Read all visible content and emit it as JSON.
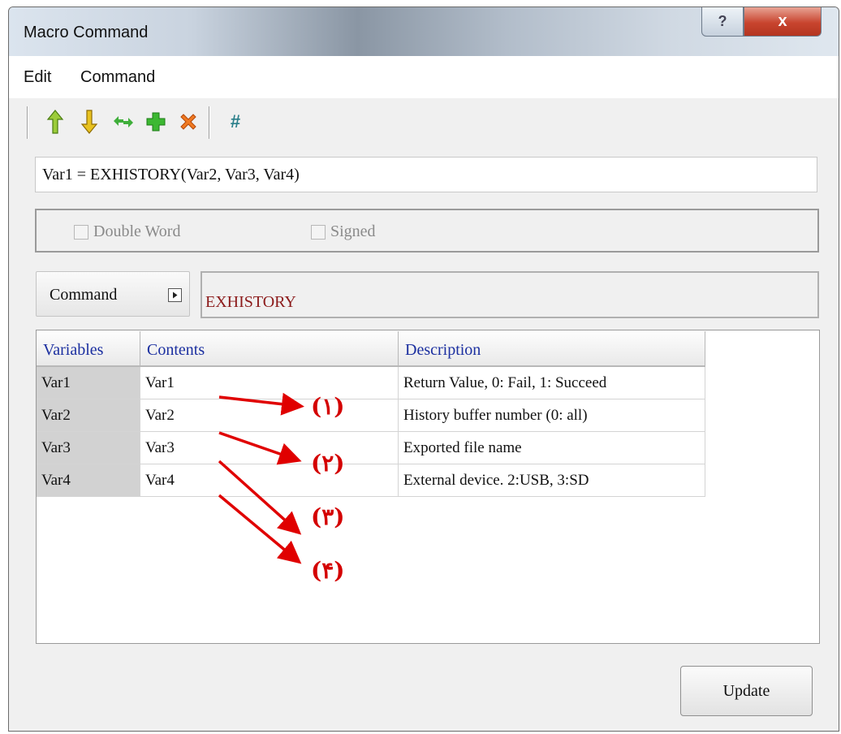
{
  "window": {
    "title": "Macro Command",
    "help_glyph": "?",
    "close_glyph": "x"
  },
  "menu": {
    "items": [
      "Edit",
      "Command"
    ]
  },
  "toolbar": {
    "icons": [
      "move-up-icon",
      "move-down-icon",
      "replace-icon",
      "add-icon",
      "delete-icon"
    ],
    "hash_label": "#"
  },
  "expression": "Var1 = EXHISTORY(Var2, Var3, Var4)",
  "options": {
    "double_word_label": "Double Word",
    "signed_label": "Signed"
  },
  "command": {
    "button_label": "Command",
    "value": "EXHISTORY"
  },
  "table": {
    "headers": [
      "Variables",
      "Contents",
      "Description"
    ],
    "rows": [
      {
        "variable": "Var1",
        "content": "Var1",
        "description": "Return Value, 0: Fail, 1: Succeed"
      },
      {
        "variable": "Var2",
        "content": "Var2",
        "description": "History buffer number (0: all)"
      },
      {
        "variable": "Var3",
        "content": "Var3",
        "description": "Exported file name"
      },
      {
        "variable": "Var4",
        "content": "Var4",
        "description": "External device. 2:USB, 3:SD"
      }
    ]
  },
  "annotations": [
    "(١)",
    "(٢)",
    "(٣)",
    "(۴)"
  ],
  "colors": {
    "annotation": "#e00000",
    "header_text": "#1b2fa0",
    "command_text": "#8b1a1a"
  },
  "update_label": "Update"
}
